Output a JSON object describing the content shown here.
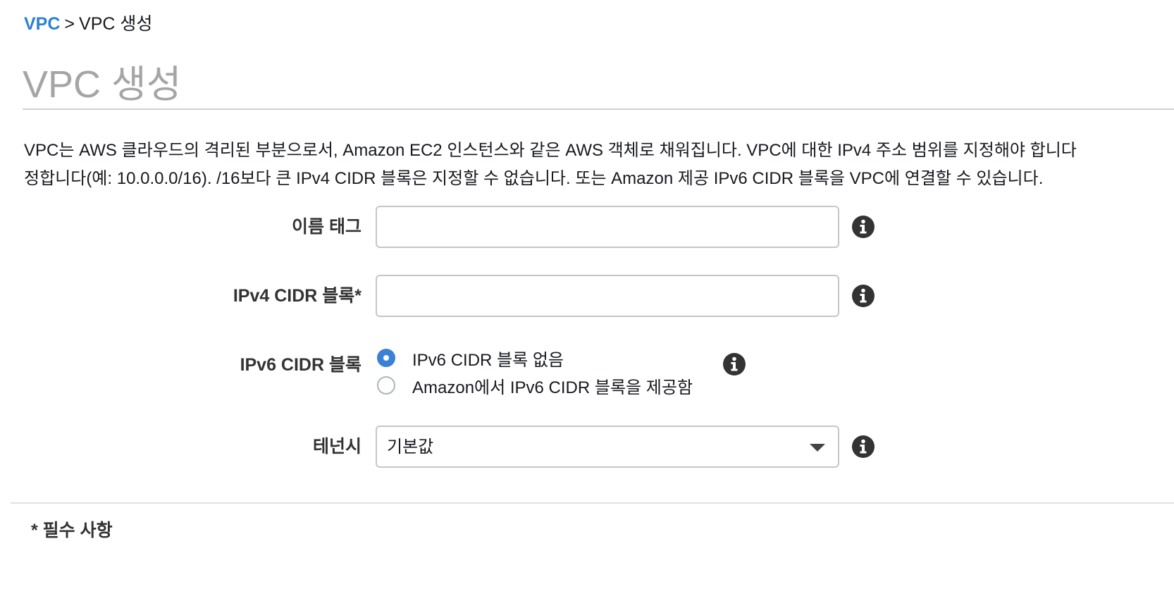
{
  "breadcrumb": {
    "link": "VPC",
    "separator": ">",
    "current": "VPC 생성"
  },
  "page_title": "VPC 생성",
  "description": {
    "line1": "VPC는 AWS 클라우드의 격리된 부분으로서, Amazon EC2 인스턴스와 같은 AWS 객체로 채워집니다. VPC에 대한 IPv4 주소 범위를 지정해야 합니다",
    "line2": "정합니다(예: 10.0.0.0/16). /16보다 큰 IPv4 CIDR 블록은 지정할 수 없습니다. 또는 Amazon 제공 IPv6 CIDR 블록을 VPC에 연결할 수 있습니다."
  },
  "form": {
    "name_tag": {
      "label": "이름 태그",
      "value": "",
      "placeholder": ""
    },
    "ipv4_cidr": {
      "label": "IPv4 CIDR 블록*",
      "value": "",
      "placeholder": ""
    },
    "ipv6_cidr": {
      "label": "IPv6 CIDR 블록",
      "options": [
        {
          "label": "IPv6 CIDR 블록 없음",
          "selected": true
        },
        {
          "label": "Amazon에서 IPv6 CIDR 블록을 제공함",
          "selected": false
        }
      ]
    },
    "tenancy": {
      "label": "테넌시",
      "selected": "기본값"
    }
  },
  "footer": {
    "required_note": "* 필수 사항"
  },
  "icons": {
    "info": "info-icon",
    "caret": "chevron-down-icon"
  },
  "colors": {
    "link": "#2d80d2",
    "radio_selected": "#3b82d6",
    "title": "#a5a5a5",
    "icon": "#333333"
  }
}
